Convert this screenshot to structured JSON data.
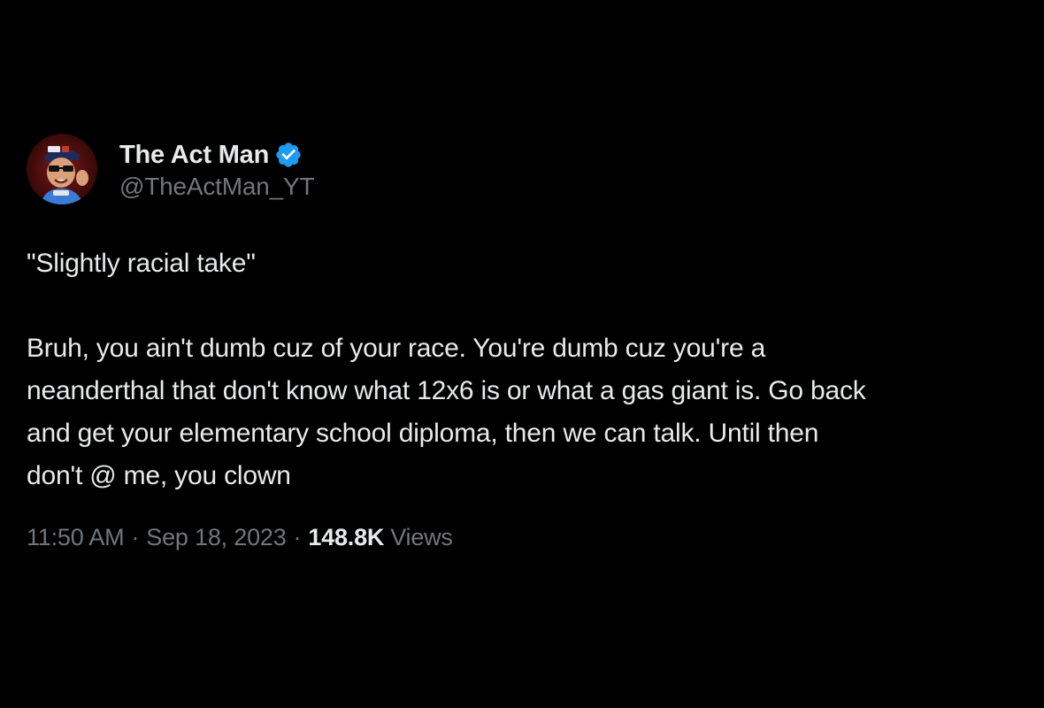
{
  "tweet": {
    "author": {
      "display_name": "The Act Man",
      "handle": "@TheActMan_YT",
      "verified": true,
      "verified_color": "#1d9bf0"
    },
    "text": {
      "quote_line": "\"Slightly racial take\"",
      "paragraph_lines": [
        "Bruh, you ain't dumb cuz of your race. You're dumb cuz you're a",
        "neanderthal that don't know what 12x6 is or what a gas giant is. Go back",
        "and get your elementary school diploma, then we can talk. Until then",
        "don't @ me, you clown"
      ]
    },
    "meta": {
      "time": "11:50 AM",
      "separator": "·",
      "date": "Sep 18, 2023",
      "views_count": "148.8K",
      "views_label": "Views"
    }
  },
  "colors": {
    "background": "#000000",
    "primary_text": "#e7e9ea",
    "secondary_text": "#71767b"
  }
}
